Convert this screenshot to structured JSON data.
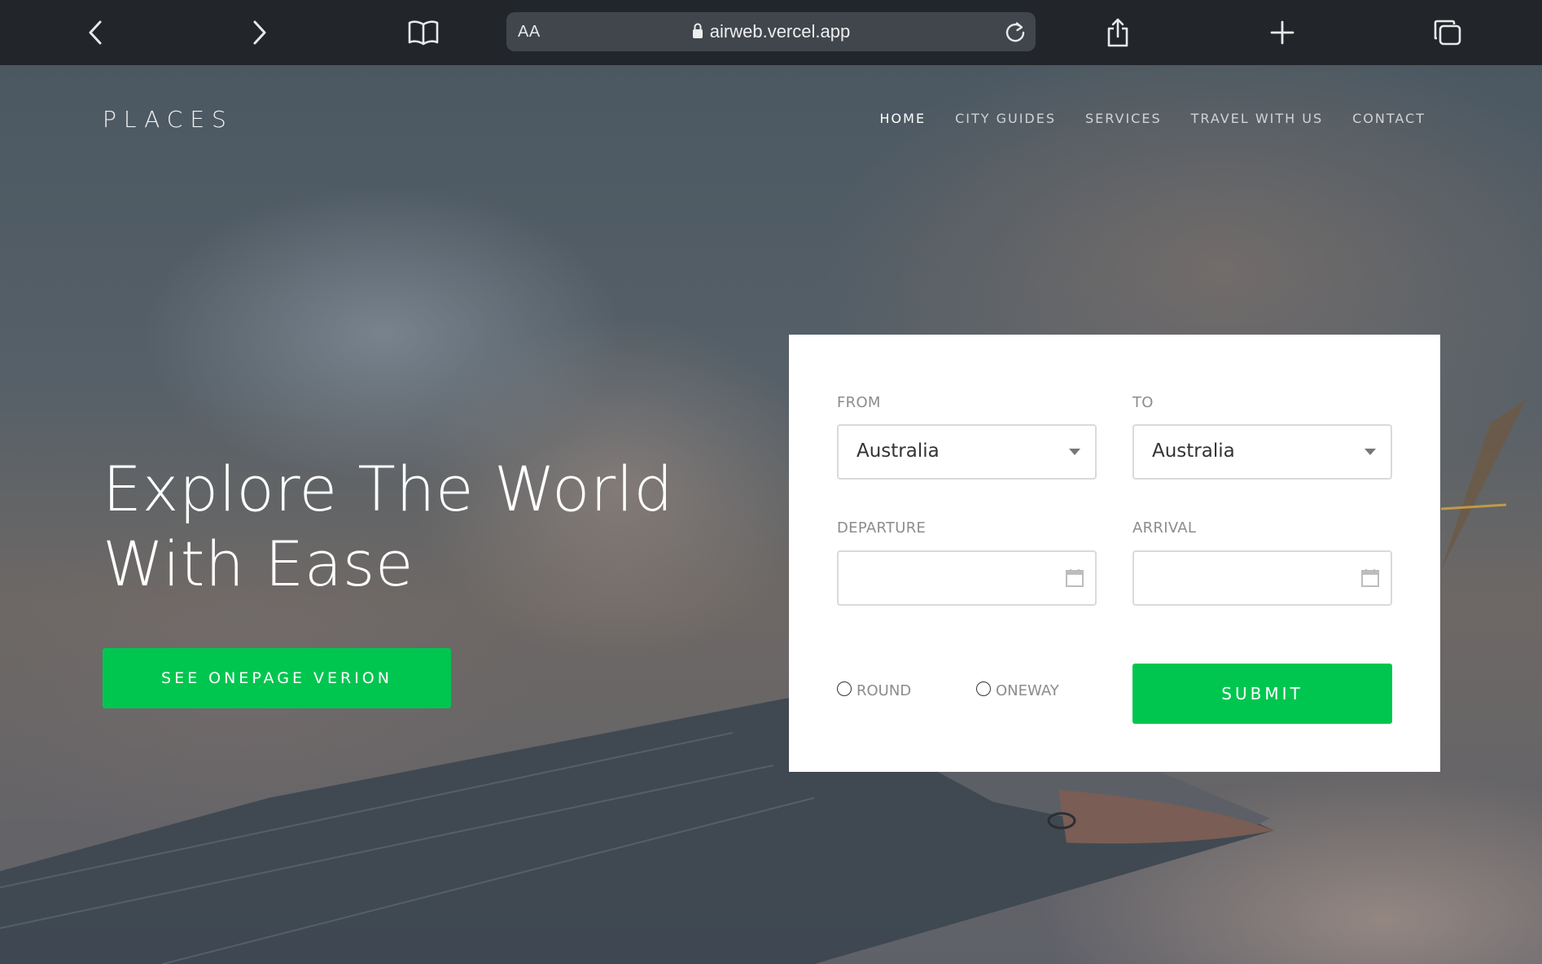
{
  "browser": {
    "text_size_label": "AA",
    "url": "airweb.vercel.app",
    "icons": [
      "back-icon",
      "forward-icon",
      "bookmarks-icon",
      "lock-icon",
      "reload-icon",
      "share-icon",
      "new-tab-icon",
      "tabs-icon"
    ]
  },
  "site": {
    "logo": "PLACES",
    "nav": [
      {
        "label": "HOME",
        "active": true
      },
      {
        "label": "CITY GUIDES",
        "active": false
      },
      {
        "label": "SERVICES",
        "active": false
      },
      {
        "label": "TRAVEL WITH US",
        "active": false
      },
      {
        "label": "CONTACT",
        "active": false
      }
    ]
  },
  "hero": {
    "headline_line1": "Explore The World",
    "headline_line2": "With Ease",
    "cta_label": "SEE ONEPAGE VERION"
  },
  "form": {
    "from_label": "FROM",
    "from_value": "Australia",
    "to_label": "TO",
    "to_value": "Australia",
    "departure_label": "DEPARTURE",
    "departure_value": "",
    "arrival_label": "ARRIVAL",
    "arrival_value": "",
    "trip_options": [
      {
        "label": "ROUND",
        "selected": false
      },
      {
        "label": "ONEWAY",
        "selected": false
      }
    ],
    "submit_label": "SUBMIT"
  },
  "colors": {
    "accent": "#00c650",
    "toolbar_bg": "#22262b",
    "address_bar_bg": "#41464d"
  }
}
